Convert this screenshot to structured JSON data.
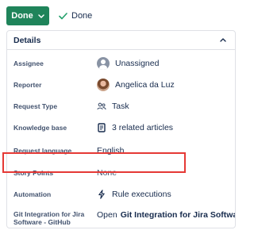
{
  "toolbar": {
    "done_button_label": "Done",
    "status_label": "Done"
  },
  "details": {
    "title": "Details",
    "fields": [
      {
        "name": "Assignee",
        "value": "Unassigned"
      },
      {
        "name": "Reporter",
        "value": "Angelica da Luz"
      },
      {
        "name": "Request Type",
        "value": "Task"
      },
      {
        "name": "Knowledge base",
        "value": "3 related articles"
      },
      {
        "name": "Request language",
        "value": "English"
      },
      {
        "name": "Story Points",
        "value": "None"
      },
      {
        "name": "Automation",
        "value": "Rule executions"
      },
      {
        "name_line1": "Git Integration for Jira",
        "name_line2": "Software - GitHub",
        "value_prefix": "Open",
        "value_link": "Git Integration for Jira Software..."
      }
    ]
  },
  "colors": {
    "primary_button": "#1f845a",
    "highlight_box": "#e53935"
  }
}
